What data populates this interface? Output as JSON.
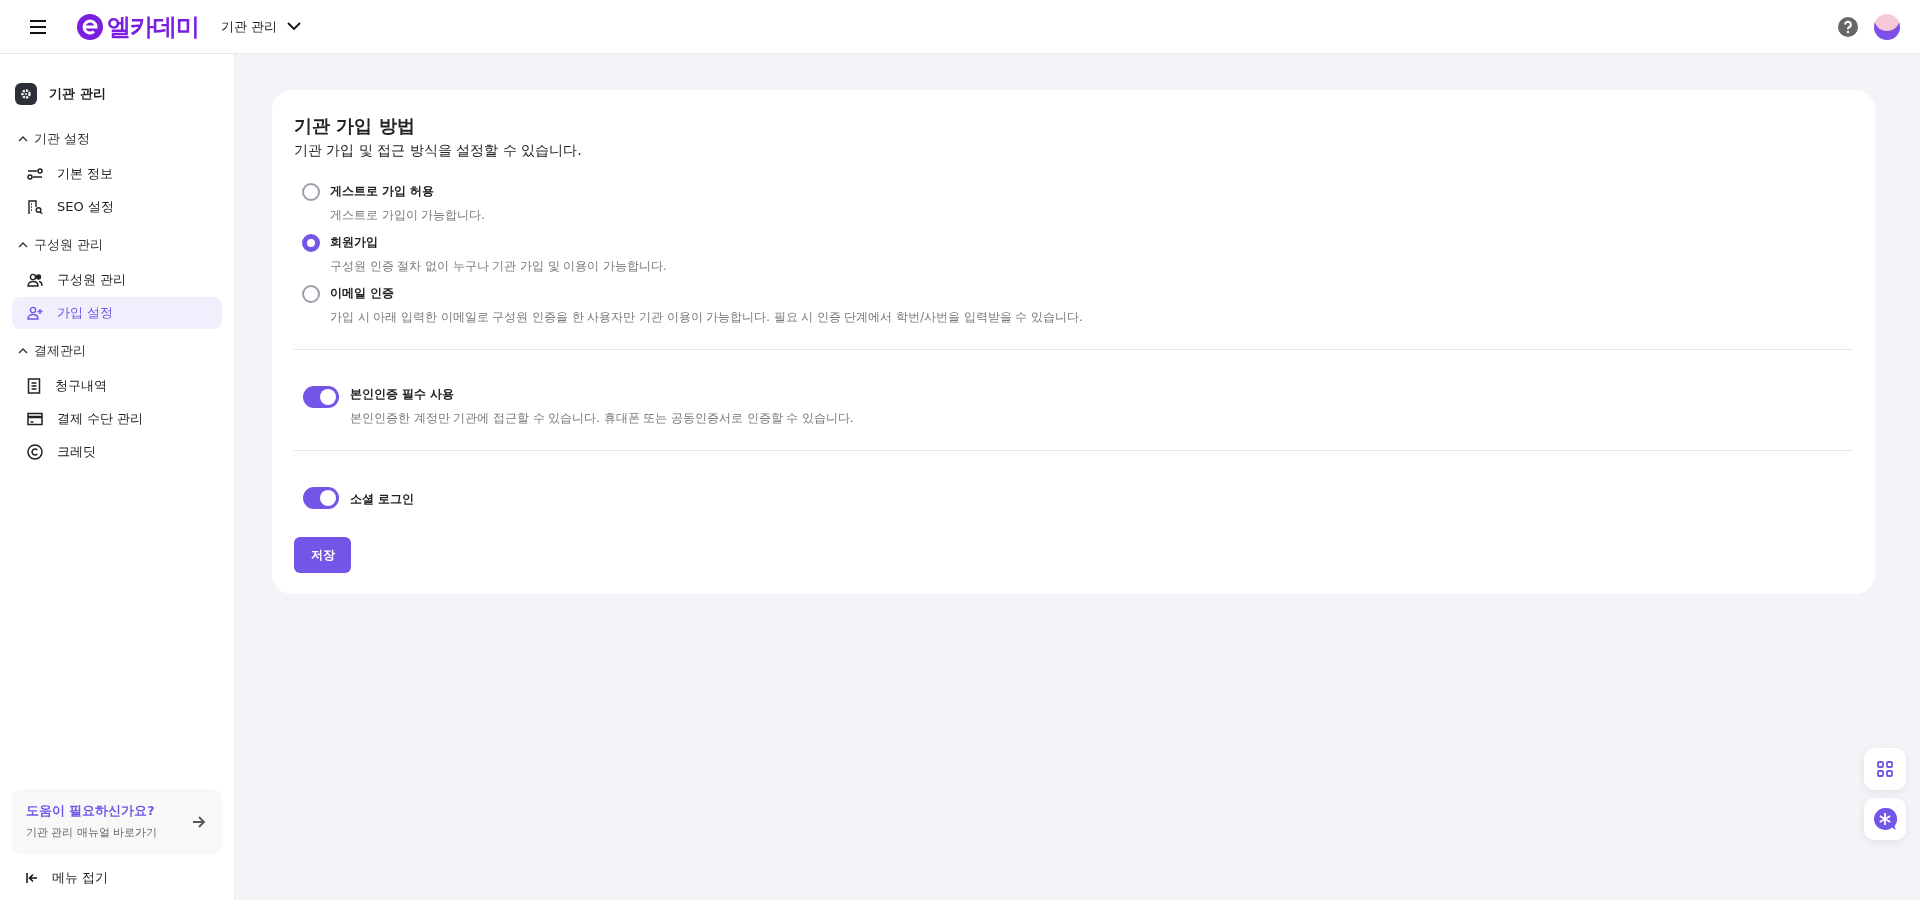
{
  "header": {
    "brand": "엘카데미",
    "org_selector": "기관 관리"
  },
  "sidebar": {
    "title": "기관 관리",
    "groups": [
      {
        "label": "기관 설정",
        "expanded": true,
        "items": [
          {
            "label": "기본 정보",
            "selected": false
          },
          {
            "label": "SEO 설정",
            "selected": false
          }
        ]
      },
      {
        "label": "구성원 관리",
        "expanded": true,
        "items": [
          {
            "label": "구성원 관리",
            "selected": false
          },
          {
            "label": "가입 설정",
            "selected": true
          }
        ]
      },
      {
        "label": "결제관리",
        "expanded": true,
        "items": [
          {
            "label": "청구내역",
            "selected": false
          },
          {
            "label": "결제 수단 관리",
            "selected": false
          },
          {
            "label": "크레딧",
            "selected": false
          }
        ]
      }
    ],
    "help_card": {
      "title": "도움이 필요하신가요?",
      "subtitle": "기관 관리 매뉴얼 바로가기"
    },
    "collapse": "메뉴 접기"
  },
  "card": {
    "title": "기관 가입 방법",
    "subtitle": "기관 가입 및 접근 방식을 설정할 수 있습니다.",
    "options": [
      {
        "label": "게스트로 가입 허용",
        "description": "게스트로 가입이 가능합니다.",
        "selected": false
      },
      {
        "label": "회원가입",
        "description": "구성원 인증 절차 없이 누구나 기관 가입 및 이용이 가능합니다.",
        "selected": true
      },
      {
        "label": "이메일 인증",
        "description": "가입 시 아래 입력한 이메일로 구성원 인증을 한 사용자만 기관 이용이 가능합니다. 필요 시 인증 단계에서 학번/사번을 입력받을 수 있습니다.",
        "selected": false
      }
    ],
    "toggles": [
      {
        "label": "본인인증 필수 사용",
        "description": "본인인증한 계정만 기관에 접근할 수 있습니다. 휴대폰 또는 공동인증서로 인증할 수 있습니다.",
        "on": true
      },
      {
        "label": "소셜 로그인",
        "on": true
      }
    ],
    "save_button": "저장"
  }
}
